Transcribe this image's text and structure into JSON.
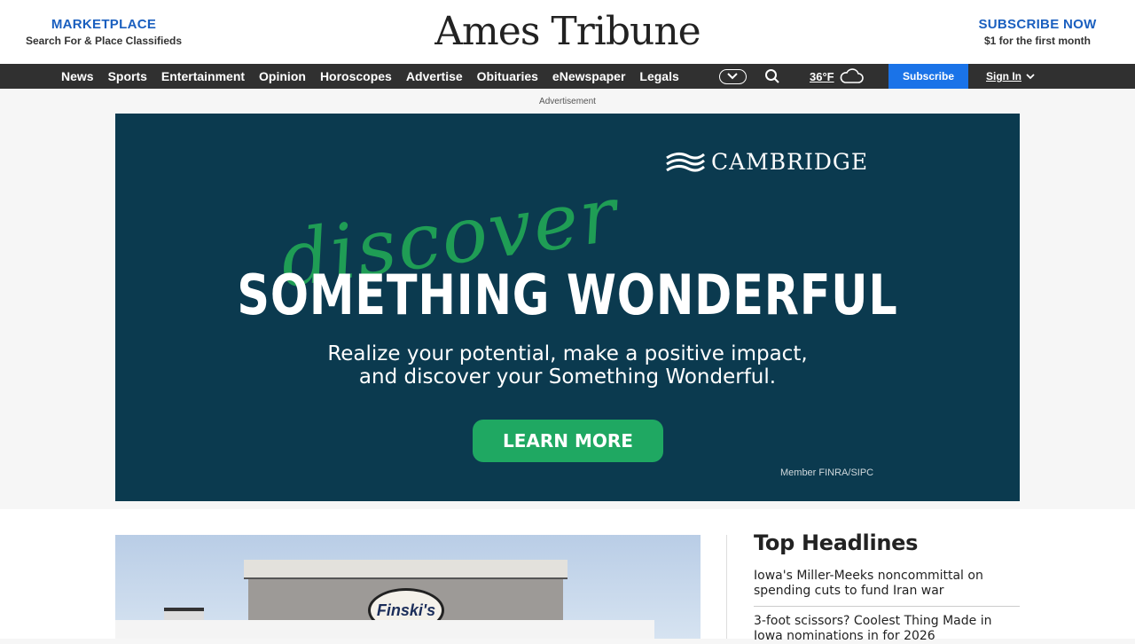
{
  "masthead": {
    "marketplace_label": "MARKETPLACE",
    "marketplace_sub": "Search For & Place Classifieds",
    "logo": "Ames Tribune",
    "subscribe_label": "SUBSCRIBE NOW",
    "subscribe_sub": "$1 for the first month"
  },
  "nav": {
    "items": [
      "News",
      "Sports",
      "Entertainment",
      "Opinion",
      "Horoscopes",
      "Advertise",
      "Obituaries",
      "eNewspaper",
      "Legals"
    ],
    "temperature": "36°F",
    "weather_icon": "cloud-icon",
    "subscribe_button": "Subscribe",
    "signin_label": "Sign In"
  },
  "ad": {
    "label": "Advertisement",
    "brand": "CAMBRIDGE",
    "script_text": "discover",
    "headline": "SOMETHING WONDERFUL",
    "body_line1": "Realize your potential, make a positive impact,",
    "body_line2": "and discover your Something Wonderful.",
    "cta": "LEARN MORE",
    "disclaimer": "Member FINRA/SIPC",
    "colors": {
      "background": "#0b3a4f",
      "accent": "#1fa862"
    }
  },
  "sidebar": {
    "title": "Top Headlines",
    "headlines": [
      "Iowa's Miller-Meeks noncommittal on spending cuts to fund Iran war",
      "3-foot scissors? Coolest Thing Made in Iowa nominations in for 2026"
    ]
  },
  "hero": {
    "sign_text": "Finski's"
  },
  "colors": {
    "brand_blue": "#1a5fbf",
    "nav_bg": "#303030",
    "subscribe_bg": "#1a73e8"
  }
}
